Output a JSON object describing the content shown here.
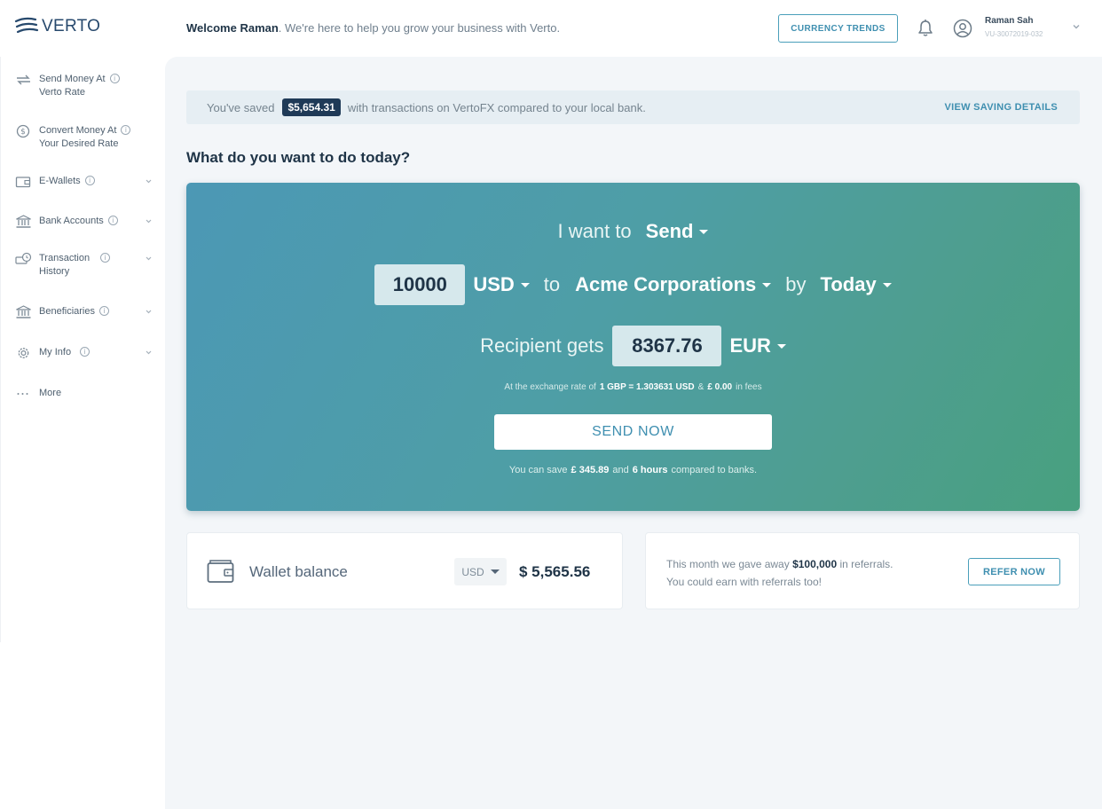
{
  "header": {
    "logo_text": "VERTO",
    "welcome_name": "Welcome Raman",
    "welcome_rest": ". We're here to help you grow your business with Verto.",
    "currency_trends": "CURRENCY TRENDS",
    "user_name": "Raman Sah",
    "user_id": "VU-30072019-032"
  },
  "sidebar": {
    "items": [
      {
        "label_1": "Send Money At",
        "label_2": "Verto Rate",
        "icon": "send-money-icon"
      },
      {
        "label_1": "Convert Money At",
        "label_2": "Your Desired Rate",
        "icon": "convert-money-icon"
      },
      {
        "label_1": "E-Wallets",
        "label_2": "",
        "icon": "wallet-icon"
      },
      {
        "label_1": "Bank Accounts",
        "label_2": "",
        "icon": "bank-icon"
      },
      {
        "label_1": "Transaction",
        "label_2": "History",
        "icon": "transaction-history-icon"
      },
      {
        "label_1": "Beneficiaries",
        "label_2": "",
        "icon": "beneficiaries-icon"
      },
      {
        "label_1": "My Info",
        "label_2": "",
        "icon": "gear-icon"
      },
      {
        "label_1": "More",
        "label_2": "",
        "icon": "more-dots-icon"
      }
    ]
  },
  "savings": {
    "prefix": "You've saved",
    "amount": "$5,654.31",
    "suffix": "with transactions on VertoFX compared to your local bank.",
    "link": "VIEW SAVING DETAILS"
  },
  "question": "What do you want to do today?",
  "transfer": {
    "i_want_to": "I want to",
    "action": "Send",
    "amount": "10000",
    "currency": "USD",
    "to": "to",
    "recipient": "Acme Corporations",
    "by": "by",
    "when": "Today",
    "recipient_gets": "Recipient gets",
    "recipient_amount": "8367.76",
    "recipient_currency": "EUR",
    "rate_pre": "At the exchange rate of",
    "rate_value": "1 GBP = 1.303631 USD",
    "rate_mid": "&",
    "rate_fees": "£ 0.00",
    "rate_post": "in fees",
    "send_button": "SEND NOW",
    "save_pre": "You can save",
    "save_amount": "£ 345.89",
    "save_mid": "and",
    "save_time": "6 hours",
    "save_post": "compared to banks."
  },
  "wallet": {
    "label": "Wallet balance",
    "currency": "USD",
    "amount": "$ 5,565.56"
  },
  "referral": {
    "line1_pre": "This month we gave away",
    "line1_amount": "$100,000",
    "line1_post": "in referrals.",
    "line2": "You could earn with referrals too!",
    "button": "REFER NOW"
  },
  "colors": {
    "accent": "#3f8fb0",
    "navy": "#1f3a57",
    "hero_start": "#4c98b5",
    "hero_end": "#48a07f"
  }
}
